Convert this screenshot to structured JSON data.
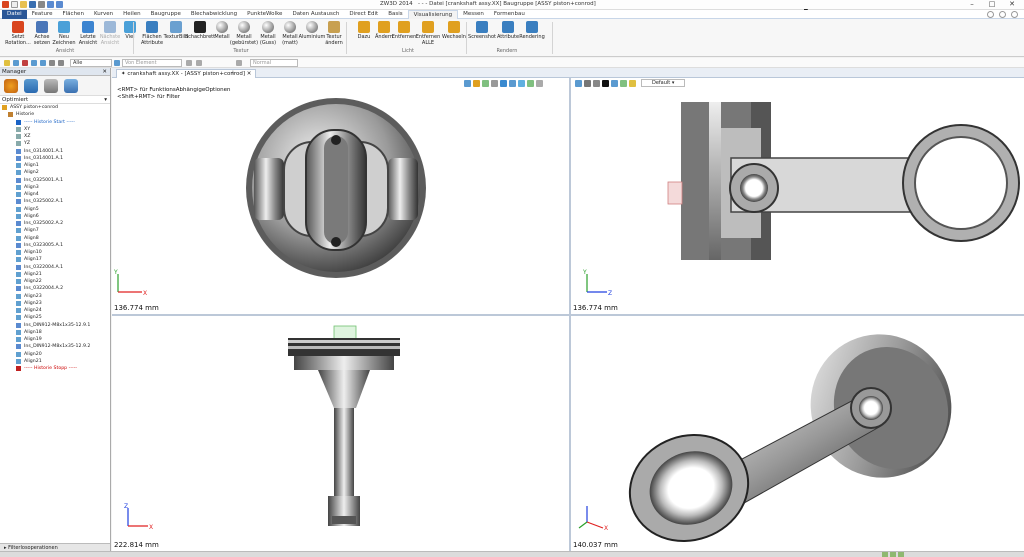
{
  "app": {
    "title": "ZW3D 2014",
    "document": "- - - Datei [crankshaft assy.XX]  Baugruppe [ASSY piston+conrod]"
  },
  "menubar": {
    "items": [
      "Datei",
      "Feature",
      "Flächen",
      "Kurven",
      "Heilen",
      "Baugruppe",
      "Blechabwicklung",
      "PunkteWolke",
      "Daten Austausch",
      "Direct Edit",
      "Basis",
      "Visualisierung",
      "Messen",
      "Formenbau"
    ],
    "active": "Visualisierung"
  },
  "ribbon": {
    "buttons": [
      {
        "label": "Setzt\nRotation...",
        "icon": "rotation-center-icon",
        "color": "#d9451e"
      },
      {
        "label": "Achse\nsetzen",
        "icon": "axis-icon",
        "color": "#4a76b8"
      },
      {
        "label": "Neu\nZeichnen",
        "icon": "redraw-icon",
        "color": "#4aa0d8"
      },
      {
        "label": "Letzte\nAnsicht",
        "icon": "last-view-icon",
        "color": "#3c84d0"
      },
      {
        "label": "Nächste\nAnsicht",
        "icon": "next-view-icon",
        "color": "#9cb8d8"
      },
      {
        "label": "Viel",
        "icon": "many-views-icon",
        "color": "#4aa0d8"
      },
      {
        "label": "Flächen\nAttribute",
        "icon": "face-attributes-icon",
        "color": "#3a7fc0"
      },
      {
        "label": "TexturBild",
        "icon": "texture-image-icon",
        "color": "#6aa0d0"
      },
      {
        "label": "Schachbrett",
        "icon": "checkerboard-icon",
        "color": "#222222"
      },
      {
        "label": "Metall",
        "icon": "metal-sphere-icon",
        "color": "#999999"
      },
      {
        "label": "Metall\n(gebürstet)",
        "icon": "brushed-metal-sphere-icon",
        "color": "#999999"
      },
      {
        "label": "Metall\n(Guss)",
        "icon": "cast-metal-sphere-icon",
        "color": "#999999"
      },
      {
        "label": "Metall\n(matt)",
        "icon": "matte-metal-sphere-icon",
        "color": "#999999"
      },
      {
        "label": "Aluminium",
        "icon": "aluminium-sphere-icon",
        "color": "#999999"
      },
      {
        "label": "Textur\nändern",
        "icon": "change-texture-icon",
        "color": "#c8a050"
      },
      {
        "label": "Dazu",
        "icon": "add-light-icon",
        "color": "#e0a020"
      },
      {
        "label": "Ändern",
        "icon": "change-light-icon",
        "color": "#e0a020"
      },
      {
        "label": "Entfernen",
        "icon": "remove-light-icon",
        "color": "#e0a020"
      },
      {
        "label": "Entfernen\nALLE",
        "icon": "remove-all-lights-icon",
        "color": "#e0a020"
      },
      {
        "label": "Wechseln",
        "icon": "switch-light-icon",
        "color": "#e0a020"
      },
      {
        "label": "Screenshot",
        "icon": "screenshot-icon",
        "color": "#3a7fc0"
      },
      {
        "label": "Attribute",
        "icon": "render-attributes-icon",
        "color": "#3a7fc0"
      },
      {
        "label": "Rendering",
        "icon": "rendering-icon",
        "color": "#3a7fc0"
      }
    ],
    "groups": [
      "Ansicht",
      "Textur",
      "Licht",
      "Rendern"
    ]
  },
  "toolbar2": {
    "filter": "Alle",
    "element": "Von Element",
    "display": "Normal"
  },
  "tab": {
    "label": "crankshaft assy.XX - [ASSY piston+conrod]"
  },
  "manager": {
    "title": "Manager",
    "dropdown": "Optimiert",
    "tree": [
      {
        "label": "ASSY piston+conrod",
        "level": "root",
        "icon": "assembly-icon"
      },
      {
        "label": "Historie",
        "level": "l1",
        "icon": "history-icon"
      },
      {
        "label": "----- Historie Start -----",
        "level": "l2",
        "icon": "history-start-icon",
        "marker": "start"
      },
      {
        "label": "XY",
        "level": "l2",
        "icon": "plane-icon"
      },
      {
        "label": "XZ",
        "level": "l2",
        "icon": "plane-icon"
      },
      {
        "label": "YZ",
        "level": "l2",
        "icon": "plane-icon"
      },
      {
        "label": "Ins_0314001.A.1",
        "level": "l2",
        "icon": "component-icon"
      },
      {
        "label": "Ins_0314001.A.1",
        "level": "l2",
        "icon": "component-icon"
      },
      {
        "label": "Align1",
        "level": "l2",
        "icon": "constraint-icon"
      },
      {
        "label": "Align2",
        "level": "l2",
        "icon": "constraint-icon"
      },
      {
        "label": "Ins_0325001.A.1",
        "level": "l2",
        "icon": "component-icon"
      },
      {
        "label": "Align3",
        "level": "l2",
        "icon": "constraint-icon"
      },
      {
        "label": "Align4",
        "level": "l2",
        "icon": "constraint-icon"
      },
      {
        "label": "Ins_0325002.A.1",
        "level": "l2",
        "icon": "component-icon"
      },
      {
        "label": "Align5",
        "level": "l2",
        "icon": "constraint-icon"
      },
      {
        "label": "Align6",
        "level": "l2",
        "icon": "constraint-icon"
      },
      {
        "label": "Ins_0325002.A.2",
        "level": "l2",
        "icon": "component-icon"
      },
      {
        "label": "Align7",
        "level": "l2",
        "icon": "constraint-icon"
      },
      {
        "label": "Align8",
        "level": "l2",
        "icon": "constraint-icon"
      },
      {
        "label": "Ins_0323005.A.1",
        "level": "l2",
        "icon": "component-icon"
      },
      {
        "label": "Align10",
        "level": "l2",
        "icon": "constraint-icon"
      },
      {
        "label": "Align17",
        "level": "l2",
        "icon": "constraint-icon"
      },
      {
        "label": "Ins_0322004.A.1",
        "level": "l2",
        "icon": "component-icon"
      },
      {
        "label": "Align21",
        "level": "l2",
        "icon": "constraint-icon"
      },
      {
        "label": "Align22",
        "level": "l2",
        "icon": "constraint-icon"
      },
      {
        "label": "Ins_0322004.A.2",
        "level": "l2",
        "icon": "component-icon"
      },
      {
        "label": "Align23",
        "level": "l2",
        "icon": "constraint-icon"
      },
      {
        "label": "Align23",
        "level": "l2",
        "icon": "constraint-icon"
      },
      {
        "label": "Align24",
        "level": "l2",
        "icon": "constraint-icon"
      },
      {
        "label": "Align25",
        "level": "l2",
        "icon": "constraint-icon"
      },
      {
        "label": "Ins_DIN912-M8x1x35-12.9.1",
        "level": "l2",
        "icon": "component-icon"
      },
      {
        "label": "Align18",
        "level": "l2",
        "icon": "constraint-icon"
      },
      {
        "label": "Align19",
        "level": "l2",
        "icon": "constraint-icon"
      },
      {
        "label": "Ins_DIN912-M8x1x35-12.9.2",
        "level": "l2",
        "icon": "component-icon"
      },
      {
        "label": "Align20",
        "level": "l2",
        "icon": "constraint-icon"
      },
      {
        "label": "Align21",
        "level": "l2",
        "icon": "constraint-icon"
      },
      {
        "label": "----- Historie Stopp -----",
        "level": "l2",
        "icon": "history-stop-icon",
        "marker": "stop"
      }
    ],
    "footer": "Filterlosoperationen"
  },
  "viewports": {
    "hint": "<RMT> für FunktionsAbhängigeOptionen\n<Shift+RMT> für Filter",
    "top_left": {
      "scale": "136.774 mm"
    },
    "top_right": {
      "scale": "136.774 mm",
      "view_select": "Default"
    },
    "bottom_left": {
      "scale": "222.814 mm"
    },
    "bottom_right": {
      "scale": "140.037 mm"
    }
  },
  "colors": {
    "accent": "#2b5797",
    "viewport_active_border": "#d9a0a0",
    "axis_x": "#e02020",
    "axis_y": "#2aa02a",
    "axis_z": "#2040e0"
  }
}
